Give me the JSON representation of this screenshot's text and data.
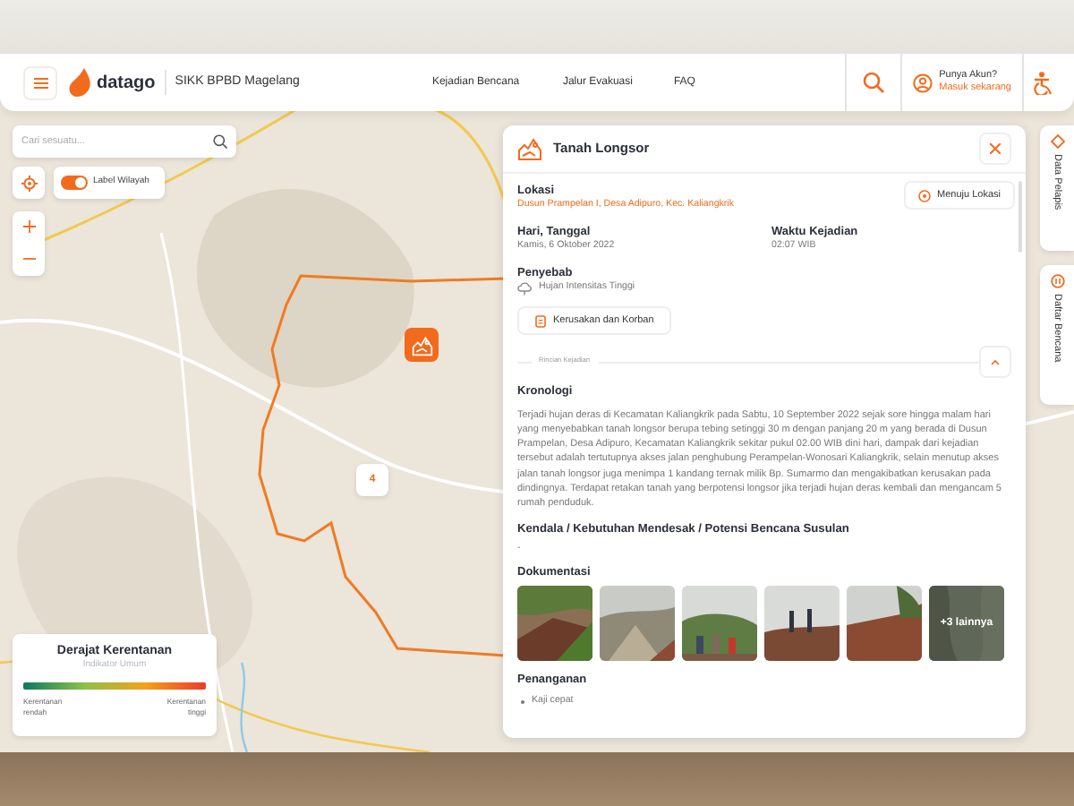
{
  "header": {
    "brand": "datago",
    "subtitle": "SIKK BPBD Magelang",
    "nav": [
      {
        "label": "Kejadian Bencana"
      },
      {
        "label": "Jalur Evakuasi"
      },
      {
        "label": "FAQ"
      }
    ],
    "account": {
      "prompt": "Punya Akun?",
      "link": "Masuk sekarang"
    }
  },
  "map_controls": {
    "search": {
      "placeholder": "Cari sesuatu..."
    },
    "label_toggle": {
      "label": "Label Wilayah",
      "on": true
    }
  },
  "map": {
    "kind": "picture",
    "markers": [
      {
        "kind": "incident"
      },
      {
        "kind": "cluster",
        "count": "4"
      }
    ]
  },
  "legend": {
    "title": "Derajat Kerentanan",
    "subtitle": "Indikator Umum",
    "low": "Kerentanan rendah",
    "high": "Kerentanan tinggi"
  },
  "side_tabs": [
    {
      "label": "Data Pelapis"
    },
    {
      "label": "Daftar Bencana"
    }
  ],
  "detail": {
    "title": "Tanah Longsor",
    "location": {
      "label": "Lokasi",
      "value": "Dusun Prampelan I, Desa Adipuro, Kec. Kaliangkrik",
      "button": "Menuju Lokasi"
    },
    "date": {
      "label": "Hari, Tanggal",
      "value": "Kamis, 6 Oktober 2022"
    },
    "time": {
      "label": "Waktu Kejadian",
      "value": "02:07 WIB"
    },
    "cause": {
      "label": "Penyebab",
      "value": "Hujan Intensitas Tinggi"
    },
    "damage_button": "Kerusakan dan Korban",
    "divider_label": "Rincian Kejadian",
    "details_expanded": true,
    "chronology": {
      "label": "Kronologi",
      "text": "Terjadi hujan deras di Kecamatan Kaliangkrik pada Sabtu, 10 September 2022 sejak sore hingga malam hari yang menyebabkan tanah longsor berupa tebing setinggi 30 m dengan panjang 20 m yang berada di Dusun Prampelan, Desa Adipuro, Kecamatan Kaliangkrik sekitar pukul 02.00 WIB dini hari, dampak dari kejadian tersebut adalah tertutupnya akses jalan penghubung Perampelan-Wonosari Kaliangkrik, selain menutup akses jalan tanah longsor juga menimpa 1 kandang ternak milik Bp. Sumarmo dan mengakibatkan kerusakan pada dindingnya. Terdapat retakan tanah yang berpotensi longsor jika terjadi hujan deras kembali dan mengancam 5 rumah penduduk."
    },
    "constraints": {
      "label": "Kendala / Kebutuhan Mendesak / Potensi Bencana Susulan",
      "value": "-"
    },
    "documentation": {
      "label": "Dokumentasi",
      "more": "+3 lainnya"
    },
    "handling": {
      "label": "Penanganan",
      "items": [
        "Kaji cepat"
      ]
    }
  }
}
